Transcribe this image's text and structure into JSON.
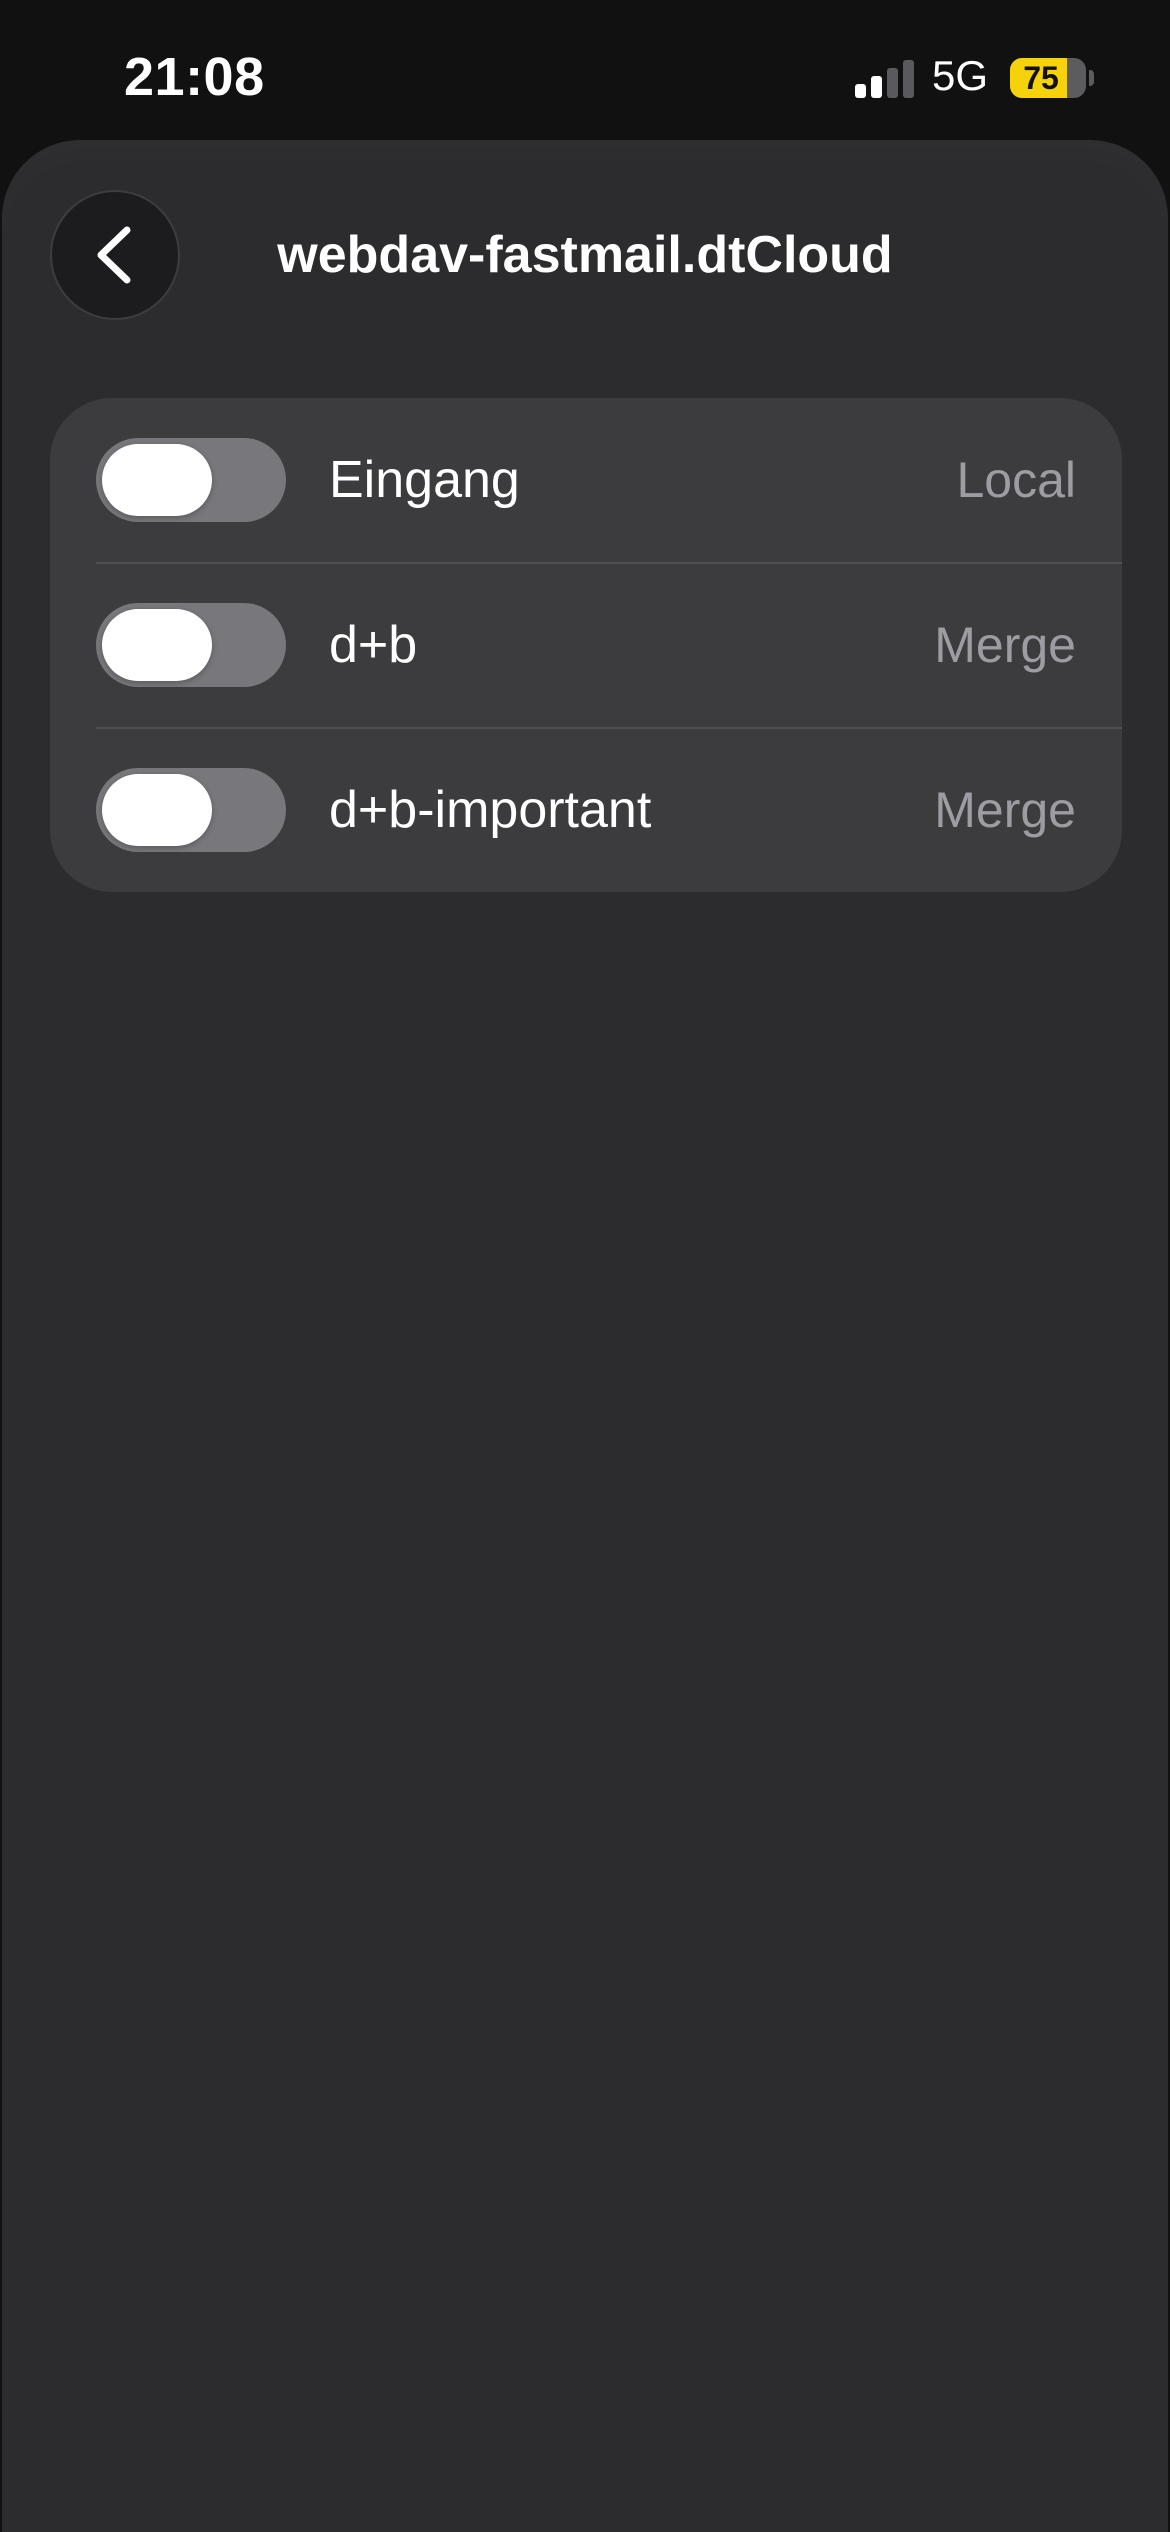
{
  "status_bar": {
    "time": "21:08",
    "network": "5G",
    "battery_level": "75",
    "battery_fraction": 0.75,
    "battery_color": "#f5d20a",
    "signal_bars_active": 2,
    "signal_bars_total": 4
  },
  "header": {
    "title": "webdav-fastmail.dtCloud",
    "back_icon": "chevron-left-icon"
  },
  "mailboxes": [
    {
      "name": "Eingang",
      "mode": "Local",
      "enabled": false
    },
    {
      "name": "d+b",
      "mode": "Merge",
      "enabled": false
    },
    {
      "name": "d+b-important",
      "mode": "Merge",
      "enabled": false
    }
  ],
  "colors": {
    "background": "#2c2c2e",
    "card": "#3c3c3e",
    "toggle_off": "#77777c",
    "secondary_text": "#9c9ca2"
  }
}
